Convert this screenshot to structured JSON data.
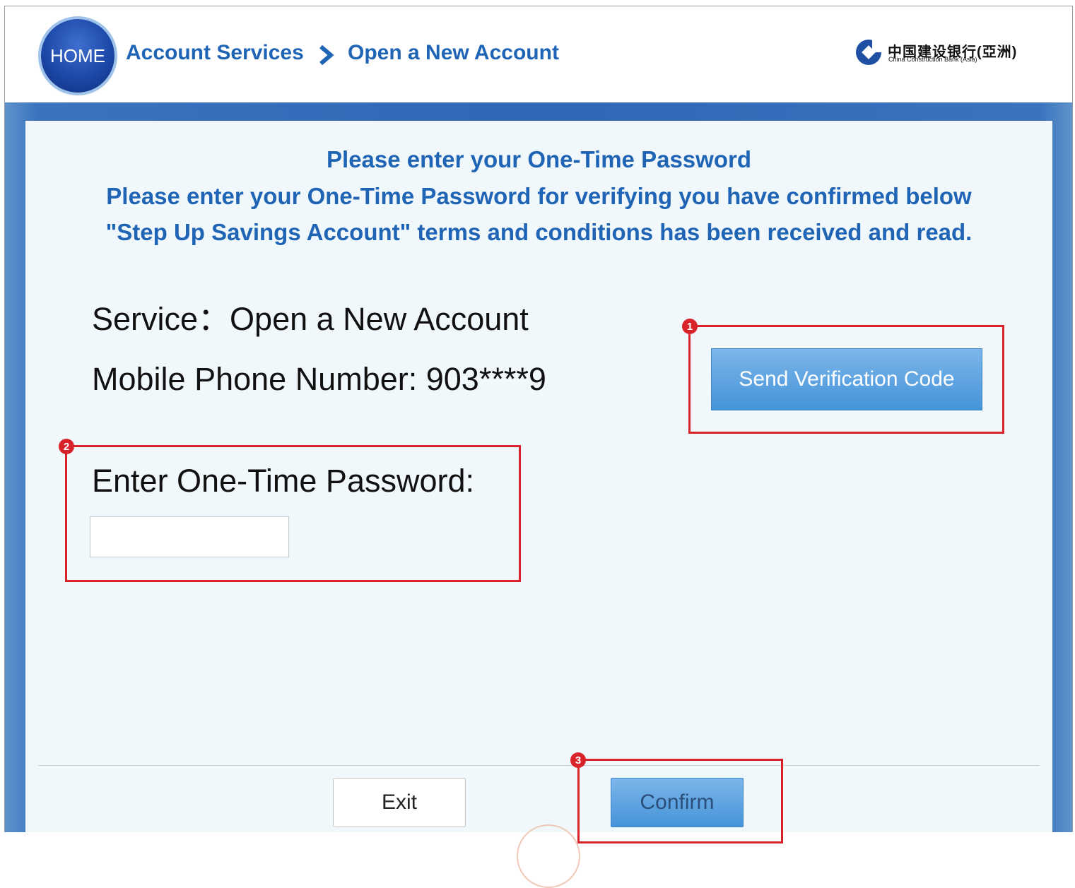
{
  "header": {
    "home_label": "HOME",
    "breadcrumb": [
      "Account Services",
      "Open a New Account"
    ],
    "bank_name_cn": "中国建设银行(亞洲)",
    "bank_name_en": "China Construction Bank (Asia)"
  },
  "main": {
    "heading": "Please enter your One-Time Password",
    "description_line1": "Please enter your One-Time Password for verifying you have confirmed below",
    "description_line2": "\"Step Up Savings Account\" terms and conditions has been received and read.",
    "service_line": "Service：Open a New Account",
    "mobile_line": "Mobile Phone Number: 903****9",
    "send_code_label": "Send Verification Code",
    "otp_label": "Enter One-Time Password:",
    "otp_value": "",
    "otp_placeholder": ""
  },
  "footer": {
    "exit_label": "Exit",
    "confirm_label": "Confirm"
  },
  "annotations": {
    "marker_1": "1",
    "marker_2": "2",
    "marker_3": "3",
    "highlight_color": "#d8232a"
  },
  "colors": {
    "brand_blue": "#1f64b5",
    "band_blue": "#2f69b6",
    "button_blue": "#4593d8",
    "panel_bg": "#f0f8fb"
  }
}
